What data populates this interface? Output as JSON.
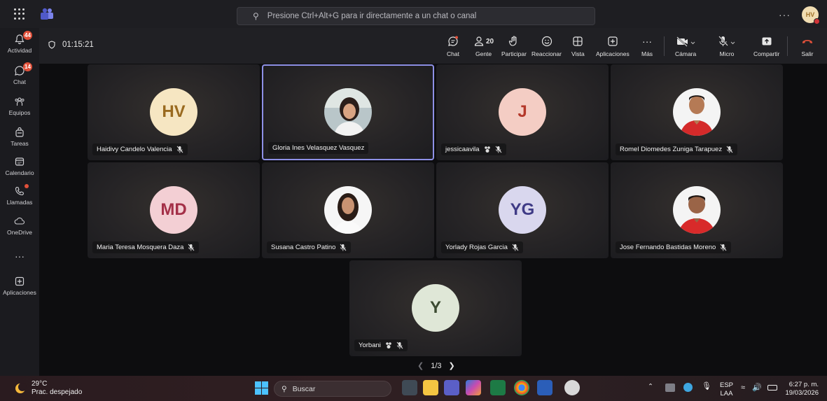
{
  "search": {
    "placeholder": "Presione Ctrl+Alt+G para ir directamente a un chat o canal"
  },
  "user": {
    "initials": "HV"
  },
  "rail": [
    {
      "label": "Actividad",
      "badge": "44"
    },
    {
      "label": "Chat",
      "badge": "14"
    },
    {
      "label": "Equipos"
    },
    {
      "label": "Tareas"
    },
    {
      "label": "Calendario"
    },
    {
      "label": "Llamadas"
    },
    {
      "label": "OneDrive"
    },
    {
      "label": "Aplicaciones"
    }
  ],
  "call": {
    "timer": "01:15:21",
    "people_count": "20",
    "controls": {
      "chat": "Chat",
      "people": "Gente",
      "raise": "Participar",
      "react": "Reaccionar",
      "view": "Vista",
      "apps": "Aplicaciones",
      "more": "Más",
      "camera": "Cámara",
      "mic": "Micro",
      "share": "Compartir",
      "leave": "Salir"
    }
  },
  "participants": [
    {
      "name": "Haidivy Candelo Valencia",
      "initials": "HV",
      "bg": "#f6e6c2",
      "fg": "#9a6a1f"
    },
    {
      "name": "Gloria Ines Velasquez Vasquez",
      "initials": "",
      "photo": true
    },
    {
      "name": "jessicaavila",
      "initials": "J",
      "bg": "#f4cdc4",
      "fg": "#b4382a"
    },
    {
      "name": "Romel Diomedes Zuniga Tarapuez",
      "initials": "",
      "photo": true
    },
    {
      "name": "Maria Teresa Mosquera Daza",
      "initials": "MD",
      "bg": "#f3cfd4",
      "fg": "#a43048"
    },
    {
      "name": "Susana Castro Patino",
      "initials": "",
      "photo": true
    },
    {
      "name": "Yorlady Rojas Garcia",
      "initials": "YG",
      "bg": "#d9d7ee",
      "fg": "#3f3b86"
    },
    {
      "name": "Jose Fernando Bastidas Moreno",
      "initials": "",
      "photo": true
    },
    {
      "name": "Yorbani",
      "initials": "Y",
      "bg": "#dfe7d7",
      "fg": "#3b4a31"
    }
  ],
  "pager": {
    "text": "1/3"
  },
  "taskbar": {
    "temp": "29°C",
    "weather": "Prac. despejado",
    "search": "Buscar",
    "lang1": "ESP",
    "lang2": "LAA",
    "time": "6:27 p. m.",
    "date": "19/03/2026"
  }
}
